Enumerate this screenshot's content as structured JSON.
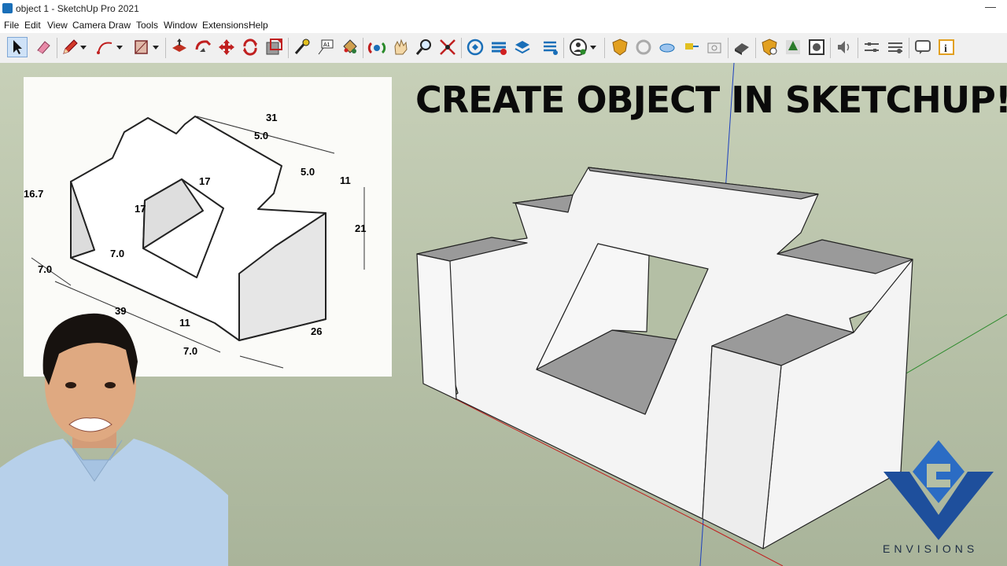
{
  "window": {
    "title": "object 1 - SketchUp Pro 2021"
  },
  "menu": [
    "File",
    "Edit",
    "View",
    "Camera",
    "Draw",
    "Tools",
    "Window",
    "Extensions",
    "Help"
  ],
  "toolbar_icons": [
    "select-icon",
    "eraser-icon",
    "pencil-icon",
    "arc-icon",
    "rectangle-icon",
    "push-pull-icon",
    "follow-me-icon",
    "move-icon",
    "rotate-icon",
    "scale-icon",
    "tape-measure-icon",
    "text-icon",
    "paint-bucket-icon",
    "orbit-icon",
    "pan-icon",
    "zoom-icon",
    "zoom-extents-icon",
    "warehouse-icon",
    "extension-warehouse-icon",
    "layer-icon",
    "style-icon",
    "user-icon",
    "shield-icon",
    "refresh-icon",
    "cloud-icon",
    "send-icon",
    "camera-icon",
    "sandbox-icon",
    "shield-plus-icon",
    "tree-icon",
    "photo-icon",
    "sound-icon",
    "settings-icon",
    "tune-icon",
    "chat-icon",
    "info-icon"
  ],
  "headline": "CREATE OBJECT IN SKETCHUP!",
  "drawing_dims": {
    "d31": "31",
    "d50a": "5.0",
    "d50b": "5.0",
    "d11a": "11",
    "d167": "16.7",
    "d17a": "17",
    "d17b": "17",
    "d21": "21",
    "d70a": "7.0",
    "d70b": "7.0",
    "d70c": "7.0",
    "d39": "39",
    "d11b": "11",
    "d26": "26"
  },
  "logo_text": "ENVISIONS",
  "colors": {
    "background": "#b4bfa5",
    "model_face": "#f4f4f4",
    "model_shadow": "#9a9a9a",
    "logo_blue": "#1e4f9c"
  }
}
